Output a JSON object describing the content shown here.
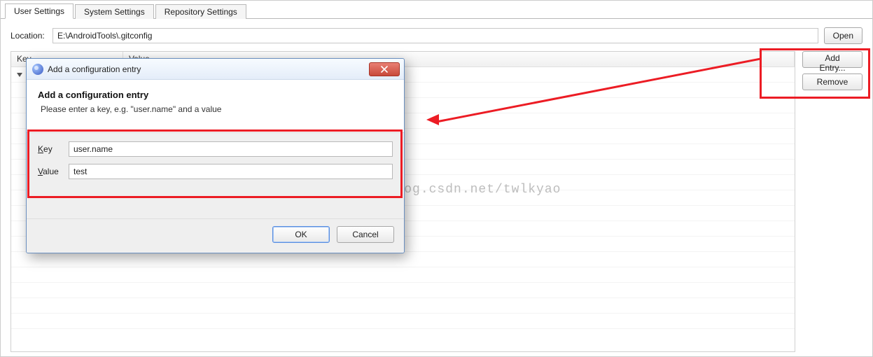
{
  "tabs": [
    {
      "label": "User Settings",
      "active": true
    },
    {
      "label": "System Settings",
      "active": false
    },
    {
      "label": "Repository Settings",
      "active": false
    }
  ],
  "location": {
    "label": "Location:",
    "value": "E:\\AndroidTools\\.gitconfig",
    "open_button": "Open"
  },
  "grid": {
    "columns": {
      "key": "Key",
      "value": "Value"
    }
  },
  "side_buttons": {
    "add_entry": "Add Entry...",
    "remove": "Remove"
  },
  "dialog": {
    "titlebar": "Add a configuration entry",
    "heading": "Add a configuration entry",
    "subtext": "Please enter a key, e.g. \"user.name\" and a value",
    "key_label": "Key",
    "key_value": "user.name",
    "value_label": "Value",
    "value_value": "test",
    "ok": "OK",
    "cancel": "Cancel"
  },
  "watermark": "http://blog.csdn.net/twlkyao"
}
